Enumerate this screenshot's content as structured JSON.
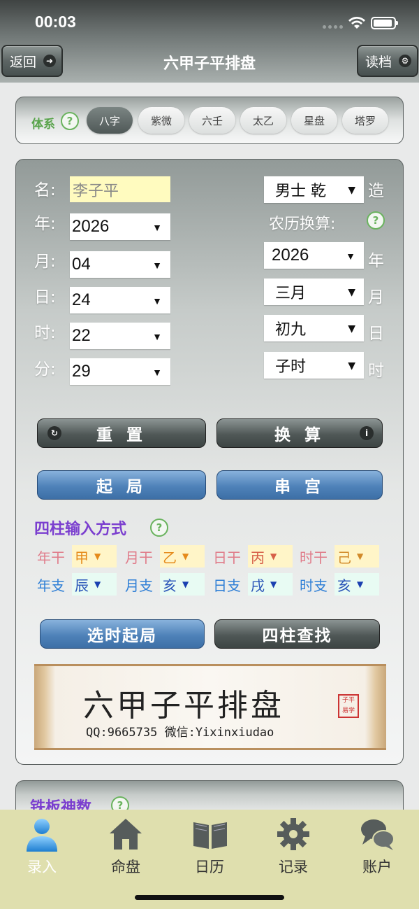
{
  "status_bar": {
    "time": "00:03"
  },
  "header": {
    "title": "六甲子平排盘",
    "back_label": "返回",
    "load_label": "读档"
  },
  "system": {
    "label": "体系",
    "help": "?",
    "tabs": [
      "八字",
      "紫微",
      "六壬",
      "太乙",
      "星盘",
      "塔罗"
    ],
    "active_index": 0
  },
  "form": {
    "name_label": "名:",
    "name_value": "李子平",
    "year_label": "年:",
    "year_value": "2026",
    "month_label": "月:",
    "month_value": "04",
    "day_label": "日:",
    "day_value": "24",
    "hour_label": "时:",
    "hour_value": "22",
    "minute_label": "分:",
    "minute_value": "29",
    "gender_value": "男士 乾",
    "gender_suffix": "造",
    "lunar_label": "农历换算:",
    "lunar_year_value": "2026",
    "lunar_year_suffix": "年",
    "lunar_month_value": "三月",
    "lunar_month_suffix": "月",
    "lunar_day_value": "初九",
    "lunar_day_suffix": "日",
    "lunar_hour_value": "子时",
    "lunar_hour_suffix": "时",
    "dropdown_arrow": "▼"
  },
  "buttons": {
    "reset": "重 置",
    "convert": "换 算",
    "start": "起 局",
    "palace": "串 宫",
    "select_time_start": "选时起局",
    "four_pillar_search": "四柱查找"
  },
  "four_pillars": {
    "title": "四柱输入方式",
    "stems": [
      {
        "label": "年干",
        "value": "甲",
        "color": "#e07c8a"
      },
      {
        "label": "月干",
        "value": "乙",
        "color": "#e07c8a"
      },
      {
        "label": "日干",
        "value": "丙",
        "color": "#e07c8a"
      },
      {
        "label": "时干",
        "value": "己",
        "color": "#e07c8a"
      }
    ],
    "branches": [
      {
        "label": "年支",
        "value": "辰",
        "color": "#2f7fd6"
      },
      {
        "label": "月支",
        "value": "亥",
        "color": "#2f7fd6"
      },
      {
        "label": "日支",
        "value": "戌",
        "color": "#2f7fd6"
      },
      {
        "label": "时支",
        "value": "亥",
        "color": "#2f7fd6"
      }
    ],
    "stem_arrow": "▼",
    "branch_arrow": "▼"
  },
  "banner": {
    "title": "六甲子平排盘",
    "contact": "QQ:9665735 微信:Yixinxiudao"
  },
  "iron_panel": {
    "title": "铁板神数"
  },
  "tabbar": {
    "items": [
      {
        "label": "录入",
        "icon": "user-icon"
      },
      {
        "label": "命盘",
        "icon": "home-icon"
      },
      {
        "label": "日历",
        "icon": "book-icon"
      },
      {
        "label": "记录",
        "icon": "gear-icon"
      },
      {
        "label": "账户",
        "icon": "chat-icon"
      }
    ],
    "active_index": 0
  }
}
